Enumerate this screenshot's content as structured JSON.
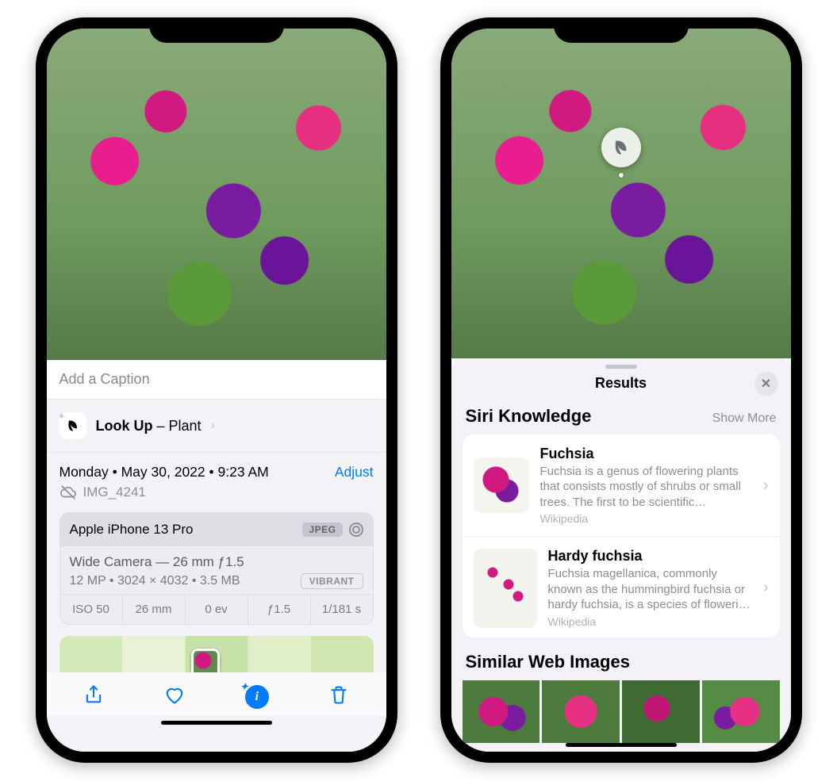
{
  "left": {
    "caption_placeholder": "Add a Caption",
    "lookup_label_bold": "Look Up",
    "lookup_label_rest": " – Plant",
    "date_line": "Monday • May 30, 2022 • 9:23 AM",
    "adjust_label": "Adjust",
    "filename": "IMG_4241",
    "device": "Apple iPhone 13 Pro",
    "format_badge": "JPEG",
    "lens_line": "Wide Camera — 26 mm ƒ1.5",
    "specs_line": "12 MP  •  3024 × 4032  •  3.5 MB",
    "style_badge": "VIBRANT",
    "stats": {
      "iso": "ISO 50",
      "focal": "26 mm",
      "ev": "0 ev",
      "aperture": "ƒ1.5",
      "shutter": "1/181 s"
    }
  },
  "right": {
    "results_title": "Results",
    "siri_section": "Siri Knowledge",
    "show_more": "Show More",
    "items": [
      {
        "title": "Fuchsia",
        "desc": "Fuchsia is a genus of flowering plants that consists mostly of shrubs or small trees. The first to be scientific…",
        "source": "Wikipedia"
      },
      {
        "title": "Hardy fuchsia",
        "desc": "Fuchsia magellanica, commonly known as the hummingbird fuchsia or hardy fuchsia, is a species of floweri…",
        "source": "Wikipedia"
      }
    ],
    "web_section": "Similar Web Images"
  }
}
